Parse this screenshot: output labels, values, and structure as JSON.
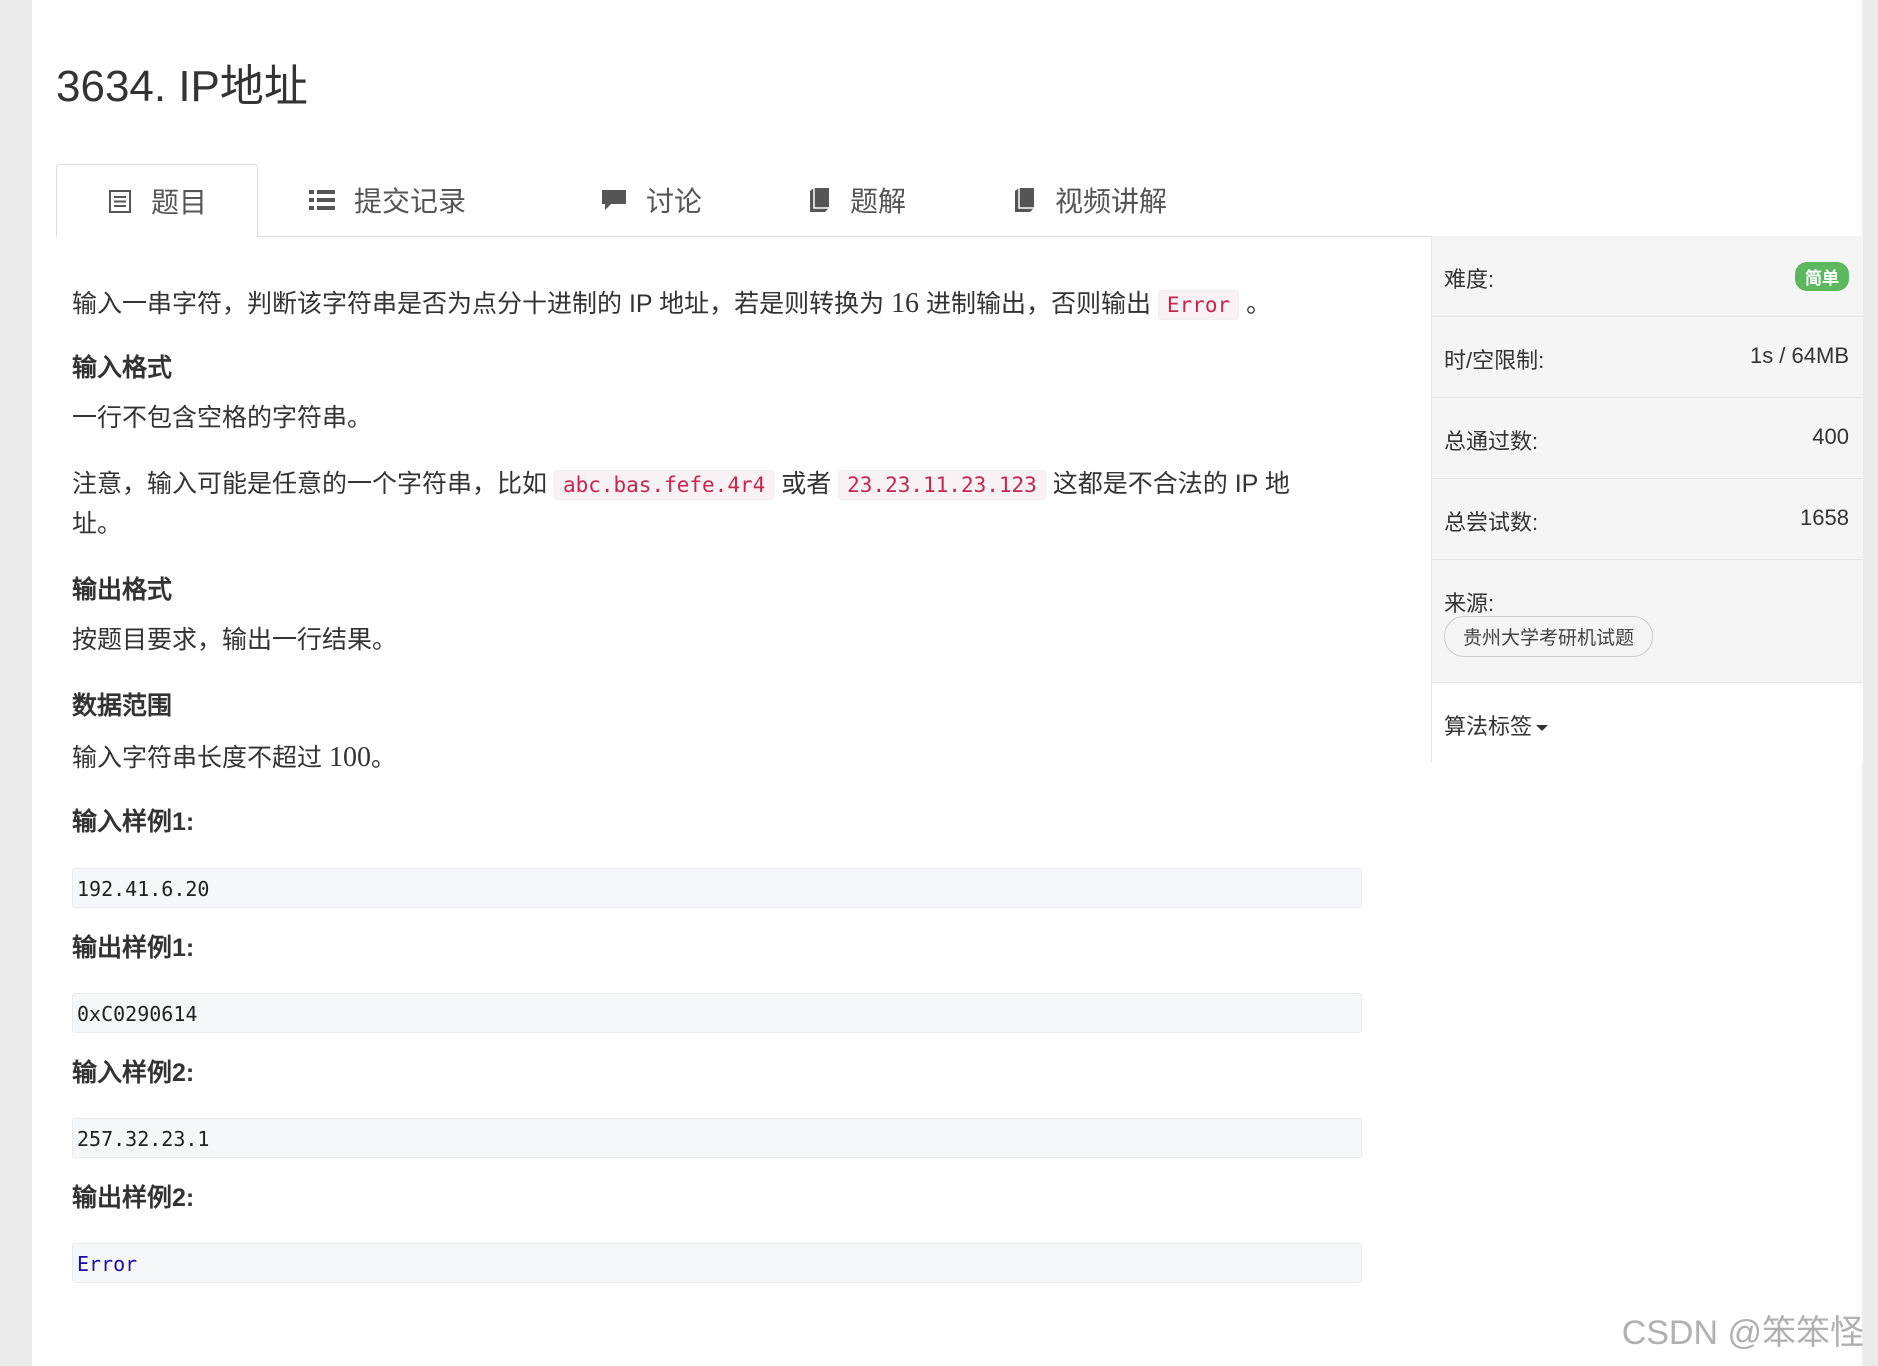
{
  "title": "3634. IP地址",
  "tabs": [
    {
      "label": "题目",
      "icon": "document-icon"
    },
    {
      "label": "提交记录",
      "icon": "list-icon"
    },
    {
      "label": "讨论",
      "icon": "comment-icon"
    },
    {
      "label": "题解",
      "icon": "book-icon"
    },
    {
      "label": "视频讲解",
      "icon": "book-icon"
    }
  ],
  "problem": {
    "desc_prefix": "输入一串字符，判断该字符串是否为点分十进制的 IP 地址，若是则转换为 ",
    "desc_num": "16",
    "desc_mid": " 进制输出，否则输出 ",
    "desc_code": "Error",
    "desc_end": " 。",
    "input_heading": "输入格式",
    "input_text": "一行不包含空格的字符串。",
    "note_prefix": "注意，输入可能是任意的一个字符串，比如 ",
    "note_code1": "abc.bas.fefe.4r4",
    "note_mid": " 或者 ",
    "note_code2": "23.23.11.23.123",
    "note_suffix": " 这都是不合法的 IP 地",
    "note_wrap": "址。",
    "output_heading": "输出格式",
    "output_text": "按题目要求，输出一行结果。",
    "range_heading": "数据范围",
    "range_prefix": "输入字符串长度不超过 ",
    "range_num": "100",
    "range_end": "。",
    "samples": [
      {
        "heading": "输入样例1:",
        "value": "192.41.6.20"
      },
      {
        "heading": "输出样例1:",
        "value": "0xC0290614"
      },
      {
        "heading": "输入样例2:",
        "value": "257.32.23.1"
      },
      {
        "heading": "输出样例2:",
        "value": "Error"
      }
    ]
  },
  "sidebar": {
    "difficulty_label": "难度:",
    "difficulty_value": "简单",
    "limit_label": "时/空限制:",
    "limit_value": "1s / 64MB",
    "passed_label": "总通过数:",
    "passed_value": "400",
    "attempts_label": "总尝试数:",
    "attempts_value": "1658",
    "source_label": "来源:",
    "source_tag": "贵州大学考研机试题",
    "tags_label": "算法标签"
  },
  "watermark": "CSDN @笨笨怪",
  "colors": {
    "badge": "#5cb85c",
    "code_text": "#c7254e",
    "error_output": "#1a0dab"
  }
}
